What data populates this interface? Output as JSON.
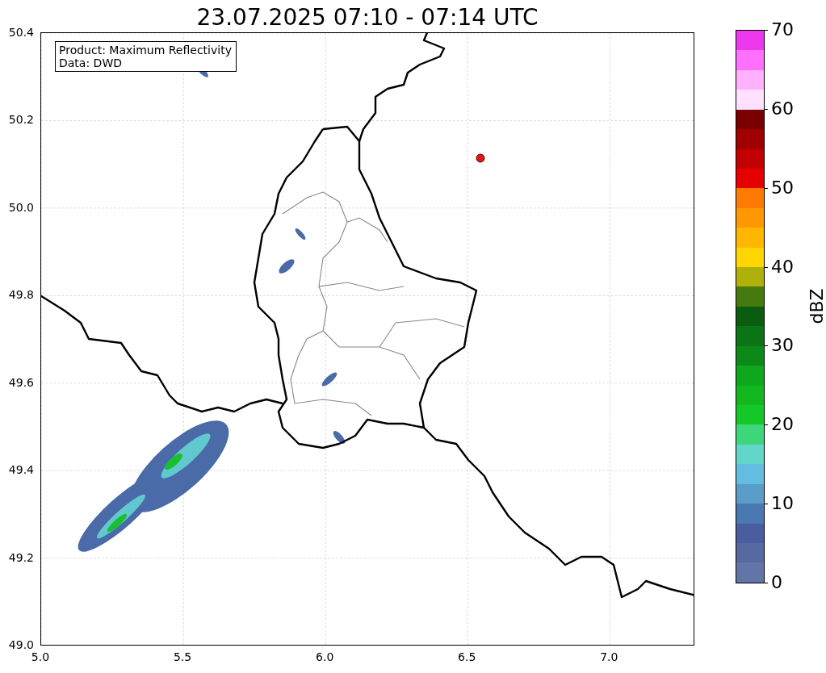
{
  "title": "23.07.2025 07:10 - 07:14 UTC",
  "info_box": {
    "lines": [
      "Product: Maximum Reflectivity",
      "Data: DWD"
    ]
  },
  "map": {
    "xticks": [
      "5.0",
      "5.5",
      "6.0",
      "6.5",
      "7.0"
    ],
    "yticks": [
      "50.4",
      "50.2",
      "50.0",
      "49.8",
      "49.6",
      "49.4",
      "49.2",
      "49.0"
    ]
  },
  "colorbar": {
    "label": "dBZ",
    "ticks": [
      "70",
      "60",
      "50",
      "40",
      "30",
      "20",
      "10",
      "0"
    ],
    "bands": [
      {
        "color": "#ee38ee"
      },
      {
        "color": "#ff70ff"
      },
      {
        "color": "#ffb0ff"
      },
      {
        "color": "#ffe0ff"
      },
      {
        "color": "#7a0000"
      },
      {
        "color": "#a00000"
      },
      {
        "color": "#c40000"
      },
      {
        "color": "#e60000"
      },
      {
        "color": "#ff7a00"
      },
      {
        "color": "#ff9800"
      },
      {
        "color": "#ffb600"
      },
      {
        "color": "#ffd600"
      },
      {
        "color": "#b0b00a"
      },
      {
        "color": "#477a0e"
      },
      {
        "color": "#0a5c10"
      },
      {
        "color": "#0a7416"
      },
      {
        "color": "#0b8a18"
      },
      {
        "color": "#0ea81c"
      },
      {
        "color": "#12b81e"
      },
      {
        "color": "#14c828"
      },
      {
        "color": "#3ed67a"
      },
      {
        "color": "#62d6c8"
      },
      {
        "color": "#62bde0"
      },
      {
        "color": "#5a9dc8"
      },
      {
        "color": "#4a78b0"
      },
      {
        "color": "#4a5d9e"
      },
      {
        "color": "#5669a0"
      },
      {
        "color": "#6374a6"
      }
    ]
  }
}
